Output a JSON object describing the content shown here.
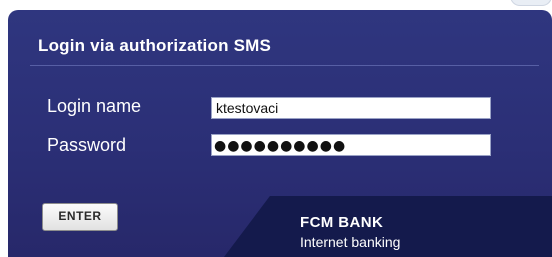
{
  "form": {
    "title": "Login via authorization SMS",
    "login_label": "Login name",
    "password_label": "Password",
    "login_value": "ktestovaci",
    "password_mask": "●●●●●●●●●●",
    "enter_label": "ENTER"
  },
  "brand": {
    "name": "FCM BANK",
    "tagline": "Internet banking"
  },
  "colors": {
    "panel": "#2f367f",
    "panel_dark": "#141a4c",
    "text": "#ffffff"
  }
}
